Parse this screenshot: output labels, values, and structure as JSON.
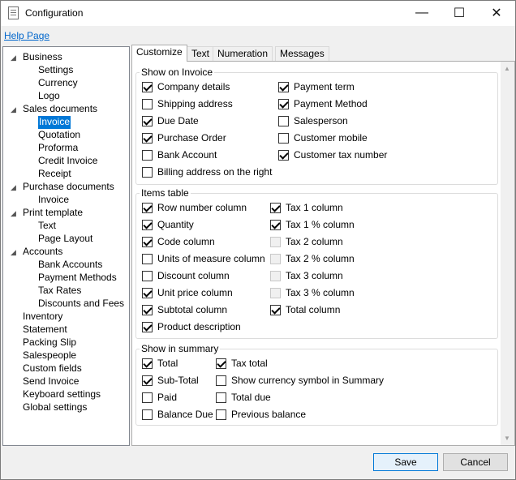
{
  "window": {
    "title": "Configuration",
    "controls": {
      "minimize": "—",
      "maximize": "☐",
      "close": "✕"
    }
  },
  "help_link": "Help Page",
  "tree": [
    {
      "label": "Business",
      "level": 0,
      "arrow": "◢"
    },
    {
      "label": "Settings",
      "level": 1
    },
    {
      "label": "Currency",
      "level": 1
    },
    {
      "label": "Logo",
      "level": 1
    },
    {
      "label": "Sales documents",
      "level": 0,
      "arrow": "◢"
    },
    {
      "label": "Invoice",
      "level": 1,
      "selected": true
    },
    {
      "label": "Quotation",
      "level": 1
    },
    {
      "label": "Proforma",
      "level": 1
    },
    {
      "label": "Credit Invoice",
      "level": 1
    },
    {
      "label": "Receipt",
      "level": 1
    },
    {
      "label": "Purchase documents",
      "level": 0,
      "arrow": "◢"
    },
    {
      "label": "Invoice",
      "level": 1
    },
    {
      "label": "Print template",
      "level": 0,
      "arrow": "◢"
    },
    {
      "label": "Text",
      "level": 1
    },
    {
      "label": "Page Layout",
      "level": 1
    },
    {
      "label": "Accounts",
      "level": 0,
      "arrow": "◢"
    },
    {
      "label": "Bank Accounts",
      "level": 1
    },
    {
      "label": "Payment Methods",
      "level": 1
    },
    {
      "label": "Tax Rates",
      "level": 1
    },
    {
      "label": "Discounts and Fees",
      "level": 1
    },
    {
      "label": "Inventory",
      "level": 0
    },
    {
      "label": "Statement",
      "level": 0
    },
    {
      "label": "Packing Slip",
      "level": 0
    },
    {
      "label": "Salespeople",
      "level": 0
    },
    {
      "label": "Custom fields",
      "level": 0
    },
    {
      "label": "Send Invoice",
      "level": 0
    },
    {
      "label": "Keyboard settings",
      "level": 0
    },
    {
      "label": "Global settings",
      "level": 0
    }
  ],
  "tabs": [
    {
      "label": "Customize",
      "active": true
    },
    {
      "label": "Text"
    },
    {
      "label": "Numeration"
    },
    {
      "label": "Messages"
    }
  ],
  "groups": {
    "show_on_invoice": {
      "label": "Show on Invoice",
      "items": [
        {
          "label": "Company details",
          "checked": true
        },
        {
          "label": "Payment term",
          "checked": true
        },
        {
          "label": "Shipping address",
          "checked": false
        },
        {
          "label": "Payment Method",
          "checked": true
        },
        {
          "label": "Due Date",
          "checked": true
        },
        {
          "label": "Salesperson",
          "checked": false
        },
        {
          "label": "Purchase Order",
          "checked": true
        },
        {
          "label": "Customer mobile",
          "checked": false
        },
        {
          "label": "Bank Account",
          "checked": false
        },
        {
          "label": "Customer tax number",
          "checked": true
        },
        {
          "label": "Billing address on the right",
          "checked": false
        }
      ]
    },
    "items_table": {
      "label": "Items table",
      "items": [
        {
          "label": "Row number column",
          "checked": true
        },
        {
          "label": "Tax 1 column",
          "checked": true
        },
        {
          "label": "Quantity",
          "checked": true
        },
        {
          "label": "Tax 1 % column",
          "checked": true
        },
        {
          "label": "Code column",
          "checked": true
        },
        {
          "label": "Tax 2 column",
          "checked": false,
          "disabled": true
        },
        {
          "label": "Units of measure column",
          "checked": false
        },
        {
          "label": "Tax 2 % column",
          "checked": false,
          "disabled": true
        },
        {
          "label": "Discount column",
          "checked": false
        },
        {
          "label": "Tax 3 column",
          "checked": false,
          "disabled": true
        },
        {
          "label": "Unit price column",
          "checked": true
        },
        {
          "label": "Tax 3 % column",
          "checked": false,
          "disabled": true
        },
        {
          "label": "Subtotal column",
          "checked": true
        },
        {
          "label": "Total column",
          "checked": true
        },
        {
          "label": "Product description",
          "checked": true
        }
      ]
    },
    "show_in_summary": {
      "label": "Show in summary",
      "items": [
        {
          "label": "Total",
          "checked": true
        },
        {
          "label": "Tax total",
          "checked": true
        },
        {
          "label": "Sub-Total",
          "checked": true
        },
        {
          "label": "Show currency symbol in Summary",
          "checked": false
        },
        {
          "label": "Paid",
          "checked": false
        },
        {
          "label": "Total due",
          "checked": false
        },
        {
          "label": "Balance Due",
          "checked": false
        },
        {
          "label": "Previous balance",
          "checked": false
        }
      ]
    }
  },
  "buttons": {
    "save": "Save",
    "cancel": "Cancel"
  }
}
